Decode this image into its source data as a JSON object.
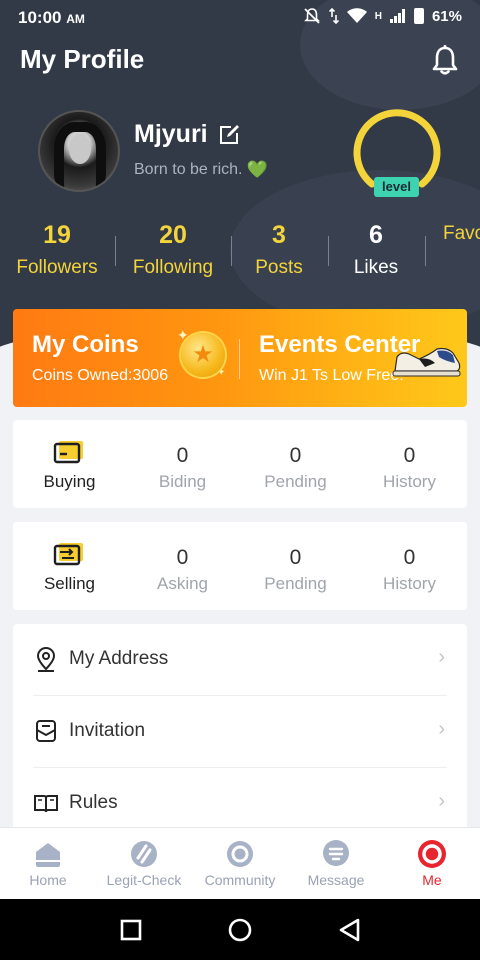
{
  "status_bar": {
    "time": "10:00",
    "ampm": "AM",
    "network": "H",
    "battery": "61%"
  },
  "header": {
    "title": "My Profile"
  },
  "profile": {
    "username": "Mjyuri",
    "bio": "Born to be rich.",
    "bio_emoji": "💚",
    "level_label": "level"
  },
  "stats": [
    {
      "value": "19",
      "label": "Followers"
    },
    {
      "value": "20",
      "label": "Following"
    },
    {
      "value": "3",
      "label": "Posts"
    },
    {
      "value": "6",
      "label": "Likes"
    },
    {
      "value": "",
      "label": "Favo"
    }
  ],
  "coins_banner": {
    "title": "My Coins",
    "subtitle": "Coins Owned:3006",
    "events_title": "Events Center",
    "events_subtitle": "Win J1 Ts Low Free!"
  },
  "buying": {
    "label": "Buying",
    "cells": [
      {
        "value": "0",
        "label": "Biding"
      },
      {
        "value": "0",
        "label": "Pending"
      },
      {
        "value": "0",
        "label": "History"
      }
    ]
  },
  "selling": {
    "label": "Selling",
    "cells": [
      {
        "value": "0",
        "label": "Asking"
      },
      {
        "value": "0",
        "label": "Pending"
      },
      {
        "value": "0",
        "label": "History"
      }
    ]
  },
  "menu": [
    {
      "label": "My Address",
      "icon": "location-pin-icon"
    },
    {
      "label": "Invitation",
      "icon": "invitation-icon"
    },
    {
      "label": "Rules",
      "icon": "book-icon"
    }
  ],
  "tabs": [
    {
      "label": "Home",
      "icon": "home-icon"
    },
    {
      "label": "Legit-Check",
      "icon": "legit-check-icon"
    },
    {
      "label": "Community",
      "icon": "community-icon"
    },
    {
      "label": "Message",
      "icon": "message-icon"
    },
    {
      "label": "Me",
      "icon": "me-icon",
      "active": true
    }
  ],
  "colors": {
    "header_bg": "#323947",
    "accent_yellow": "#f4d43b",
    "active_tab": "#e8242f",
    "level_badge": "#3ed3b0"
  }
}
